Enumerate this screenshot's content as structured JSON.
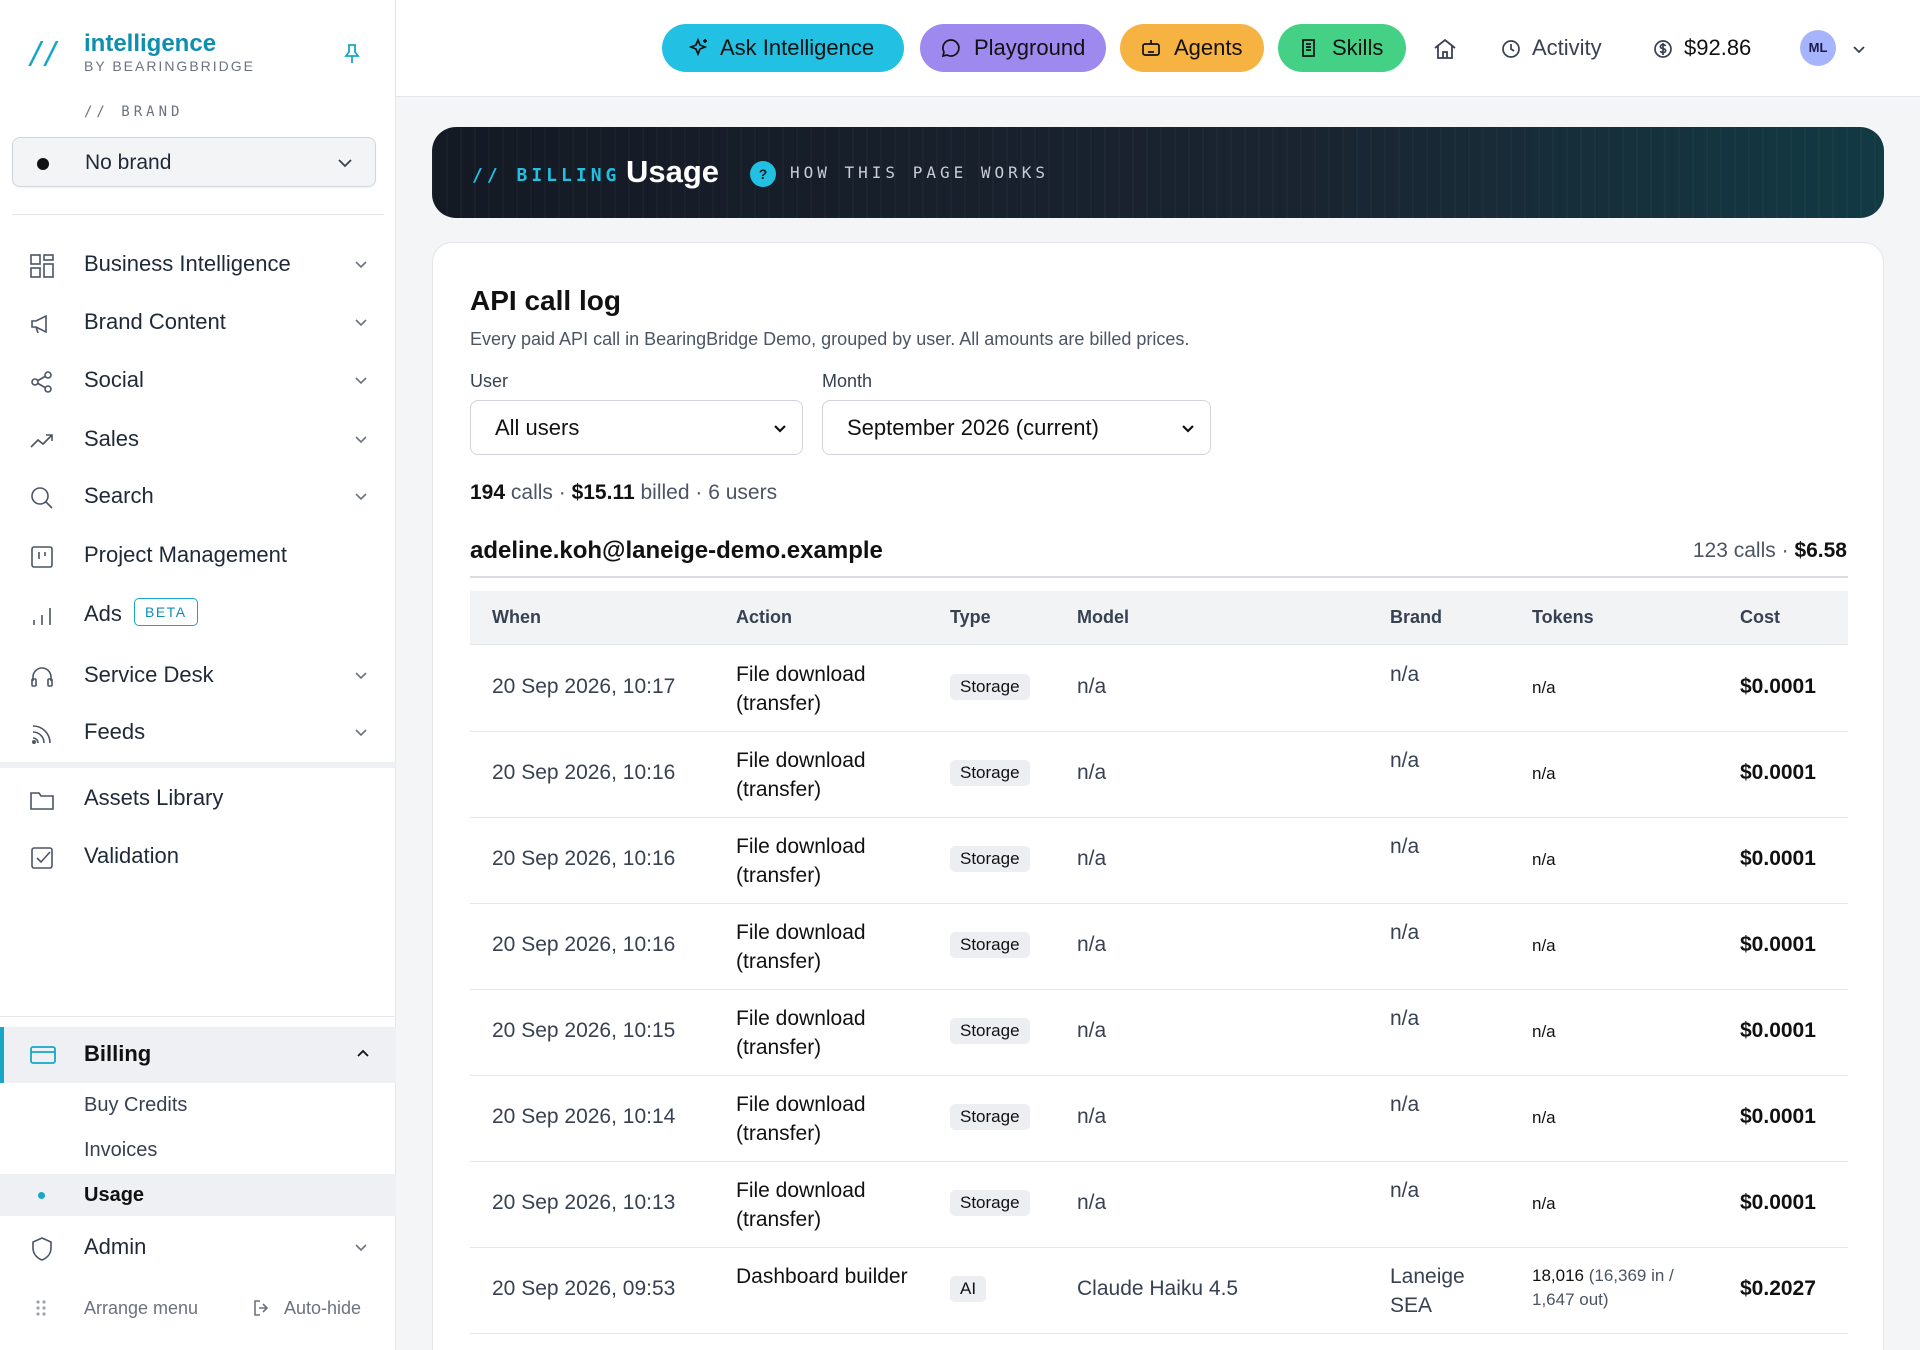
{
  "sidebar": {
    "logo_slash": "//",
    "logo_title": "intelligence",
    "logo_sub": "BY BEARINGBRIDGE",
    "brand_label": "// BRAND",
    "brand_value": "No brand",
    "nav": [
      {
        "label": "Business Intelligence",
        "icon": "grid-icon"
      },
      {
        "label": "Brand Content",
        "icon": "megaphone-icon"
      },
      {
        "label": "Social",
        "icon": "share-icon"
      },
      {
        "label": "Sales",
        "icon": "trend-icon"
      },
      {
        "label": "Search",
        "icon": "search-icon"
      },
      {
        "label": "Project Management",
        "icon": "board-icon"
      },
      {
        "label": "Ads",
        "icon": "bar-chart-icon",
        "badge": "BETA"
      },
      {
        "label": "Service Desk",
        "icon": "headset-icon"
      },
      {
        "label": "Feeds",
        "icon": "rss-icon"
      },
      {
        "label": "Assets Library",
        "icon": "folder-icon"
      },
      {
        "label": "Validation",
        "icon": "checkbox-icon"
      }
    ],
    "billing": {
      "label": "Billing",
      "children": [
        "Buy Credits",
        "Invoices",
        "Usage"
      ],
      "active_child": "Usage"
    },
    "admin_label": "Admin",
    "arrange_label": "Arrange menu",
    "autohide_label": "Auto-hide"
  },
  "topbar": {
    "ask": "Ask Intelligence",
    "playground": "Playground",
    "agents": "Agents",
    "skills": "Skills",
    "activity": "Activity",
    "balance": "$92.86",
    "avatar": "ML"
  },
  "banner": {
    "section": "// BILLING",
    "title": "Usage",
    "help_glyph": "?",
    "help_text": "HOW THIS PAGE WORKS"
  },
  "card": {
    "title": "API call log",
    "description": "Every paid API call in BearingBridge Demo, grouped by user. All amounts are billed prices.",
    "user_filter_label": "User",
    "user_filter_value": "All users",
    "month_filter_label": "Month",
    "month_filter_value": "September 2026 (current)",
    "summary": {
      "calls": "194",
      "calls_word": "calls",
      "billed": "$15.11",
      "billed_word": "billed",
      "users": "6 users"
    },
    "group": {
      "email": "adeline.koh@laneige-demo.example",
      "calls": "123 calls",
      "amount": "$6.58"
    },
    "columns": [
      "When",
      "Action",
      "Type",
      "Model",
      "Brand",
      "Tokens",
      "Cost"
    ],
    "rows": [
      {
        "when": "20 Sep 2026, 10:17",
        "action": "File download (transfer)",
        "type": "Storage",
        "model": "n/a",
        "brand": "n/a",
        "tokens": "n/a",
        "tokens_detail": "",
        "cost": "$0.0001"
      },
      {
        "when": "20 Sep 2026, 10:16",
        "action": "File download (transfer)",
        "type": "Storage",
        "model": "n/a",
        "brand": "n/a",
        "tokens": "n/a",
        "tokens_detail": "",
        "cost": "$0.0001"
      },
      {
        "when": "20 Sep 2026, 10:16",
        "action": "File download (transfer)",
        "type": "Storage",
        "model": "n/a",
        "brand": "n/a",
        "tokens": "n/a",
        "tokens_detail": "",
        "cost": "$0.0001"
      },
      {
        "when": "20 Sep 2026, 10:16",
        "action": "File download (transfer)",
        "type": "Storage",
        "model": "n/a",
        "brand": "n/a",
        "tokens": "n/a",
        "tokens_detail": "",
        "cost": "$0.0001"
      },
      {
        "when": "20 Sep 2026, 10:15",
        "action": "File download (transfer)",
        "type": "Storage",
        "model": "n/a",
        "brand": "n/a",
        "tokens": "n/a",
        "tokens_detail": "",
        "cost": "$0.0001"
      },
      {
        "when": "20 Sep 2026, 10:14",
        "action": "File download (transfer)",
        "type": "Storage",
        "model": "n/a",
        "brand": "n/a",
        "tokens": "n/a",
        "tokens_detail": "",
        "cost": "$0.0001"
      },
      {
        "when": "20 Sep 2026, 10:13",
        "action": "File download (transfer)",
        "type": "Storage",
        "model": "n/a",
        "brand": "n/a",
        "tokens": "n/a",
        "tokens_detail": "",
        "cost": "$0.0001"
      },
      {
        "when": "20 Sep 2026, 09:53",
        "action": "Dashboard builder",
        "type": "AI",
        "model": "Claude Haiku 4.5",
        "brand": "Laneige SEA",
        "tokens": "18,016",
        "tokens_detail": " (16,369 in / 1,647 out)",
        "cost": "$0.2027"
      }
    ]
  },
  "colors": {
    "accent": "#16a7c6",
    "ask": "#22c0e2",
    "playground": "#9e89ee",
    "agents": "#f7b342",
    "skills": "#44d185"
  }
}
